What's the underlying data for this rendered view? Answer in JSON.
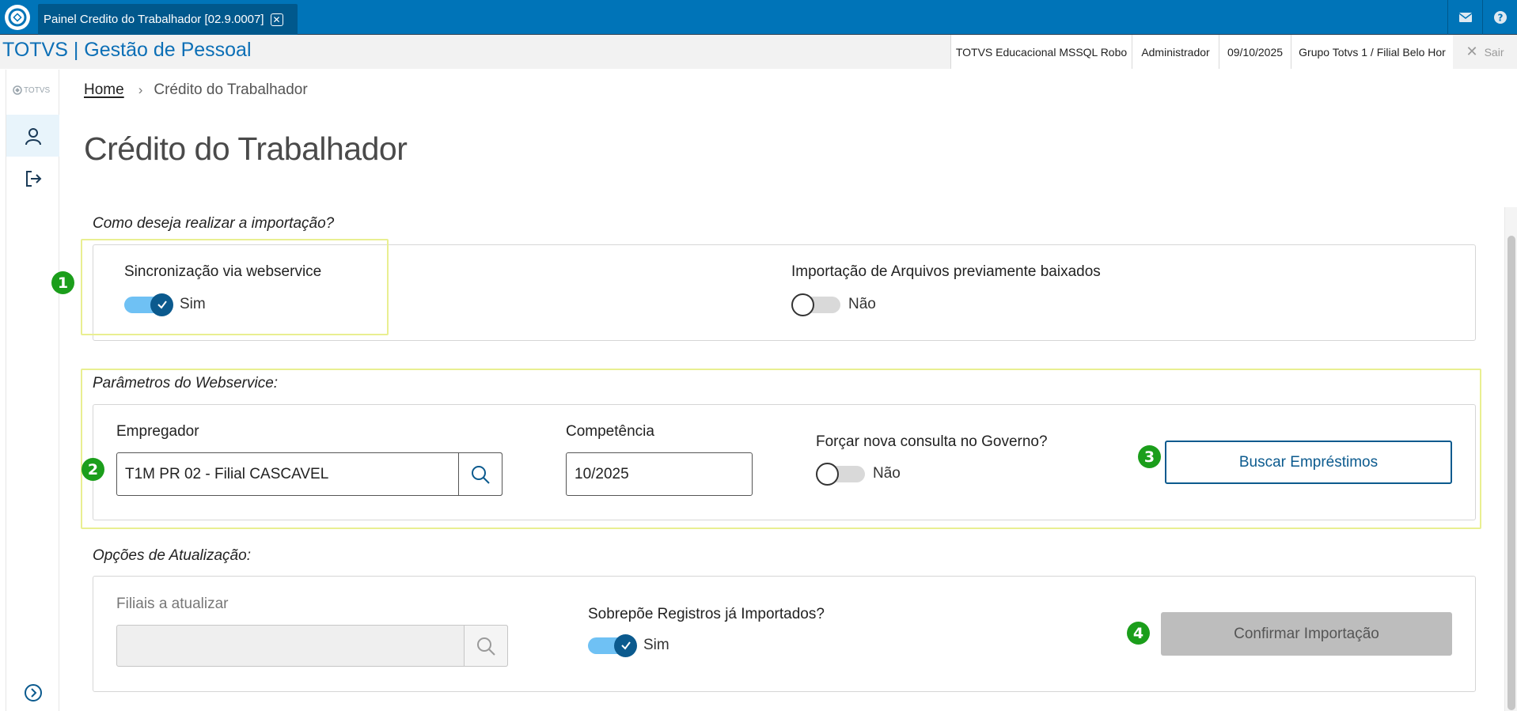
{
  "topbar": {
    "tab_title": "Painel Credito do Trabalhador [02.9.0007]",
    "icons": [
      "totvs-logo-icon",
      "close-icon",
      "mail-icon",
      "help-icon"
    ]
  },
  "header": {
    "app_title": "TOTVS | Gestão de Pessoal",
    "context": {
      "database": "TOTVS Educacional MSSQL Robo",
      "user": "Administrador",
      "date": "09/10/2025",
      "branch": "Grupo Totvs 1 / Filial Belo Hor"
    },
    "logout_label": "Sair"
  },
  "sidebar": {
    "logo_text": "TOTVS",
    "items": [
      "user-icon",
      "logout-icon"
    ],
    "expand_icon": "chevron-right-circle-icon"
  },
  "breadcrumb": {
    "home": "Home",
    "current": "Crédito do Trabalhador"
  },
  "page_title": "Crédito do Trabalhador",
  "import_mode": {
    "question": "Como deseja realizar a importação?",
    "webservice": {
      "label": "Sincronização via webservice",
      "value": "Sim",
      "on": true
    },
    "files": {
      "label": "Importação de Arquivos previamente baixados",
      "value": "Não",
      "on": false
    }
  },
  "webservice_params": {
    "title": "Parâmetros do Webservice:",
    "employer_label": "Empregador",
    "employer_value": "T1M PR 02 - Filial CASCAVEL",
    "competence_label": "Competência",
    "competence_value": "10/2025",
    "force_label": "Forçar nova consulta no Governo?",
    "force_value": "Não",
    "search_button": "Buscar Empréstimos"
  },
  "update_options": {
    "title": "Opções de Atualização:",
    "branches_label": "Filiais a atualizar",
    "branches_value": "",
    "overwrite_label": "Sobrepõe Registros já Importados?",
    "overwrite_value": "Sim",
    "confirm_button": "Confirmar Importação"
  },
  "badges": [
    "1",
    "2",
    "3",
    "4"
  ],
  "colors": {
    "topbar": "#0074b8",
    "primary": "#0b5a8e",
    "badge": "#1b9e1b",
    "highlight": "#e9ef91"
  }
}
